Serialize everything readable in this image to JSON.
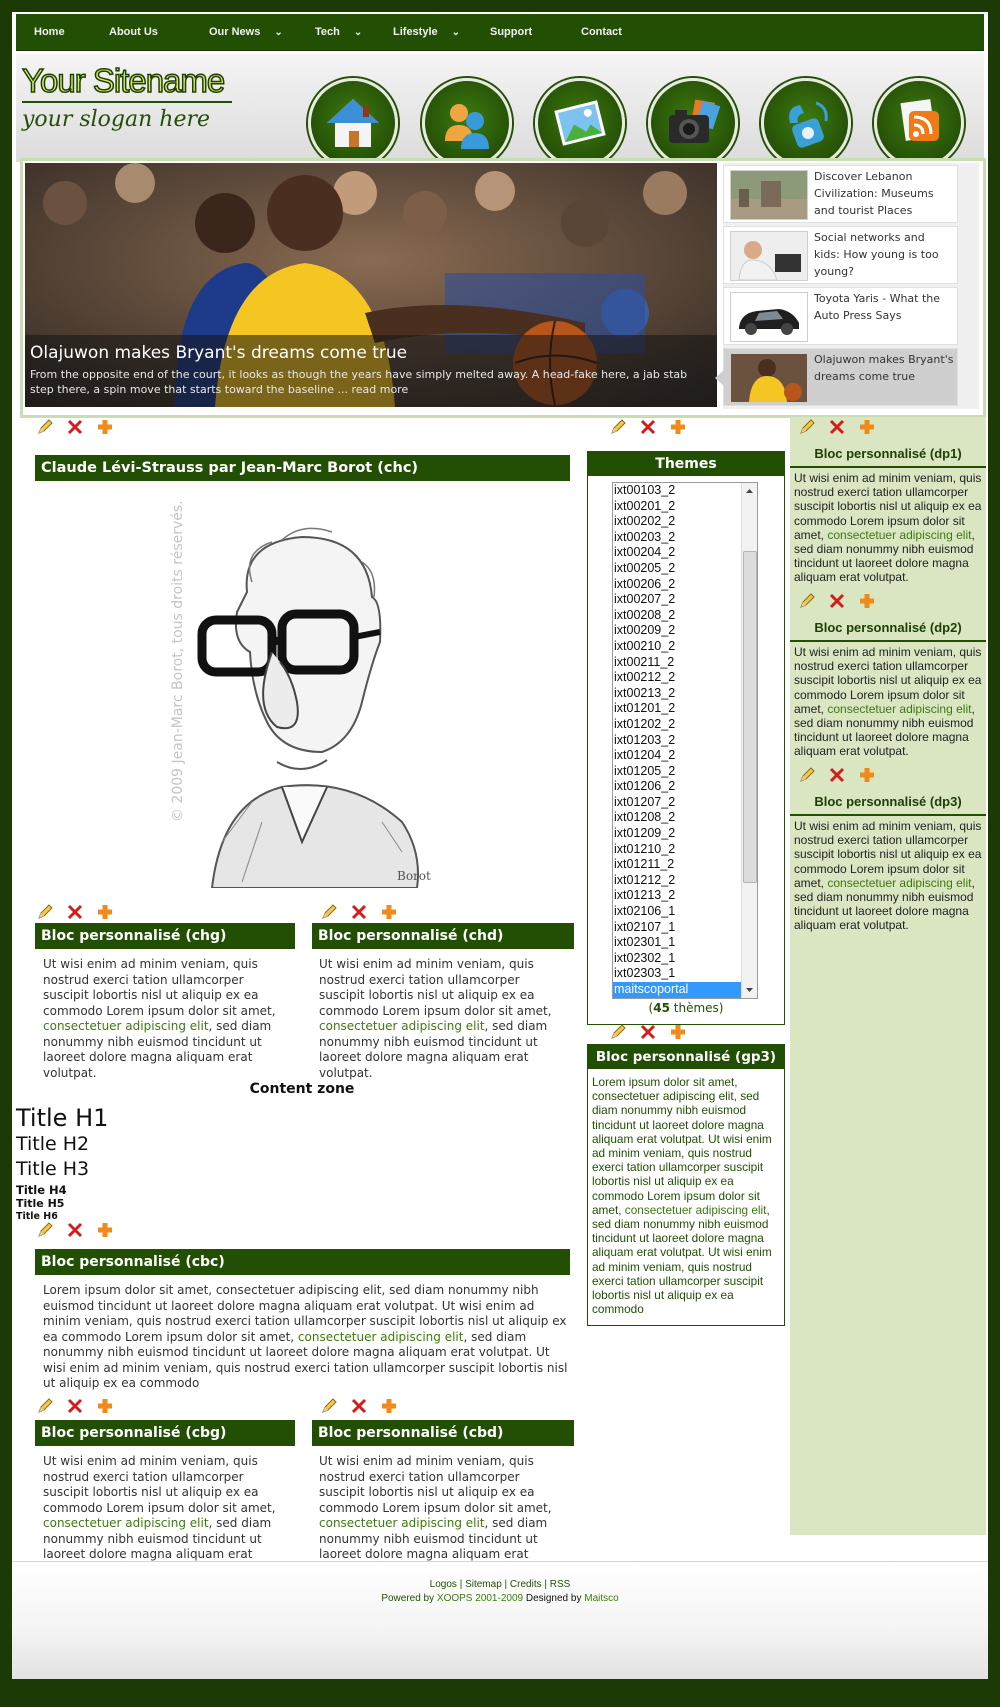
{
  "nav": [
    {
      "label": "Home",
      "has_menu": false
    },
    {
      "label": "About Us",
      "has_menu": false
    },
    {
      "label": "Our News",
      "has_menu": true
    },
    {
      "label": "Tech",
      "has_menu": true
    },
    {
      "label": "Lifestyle",
      "has_menu": true
    },
    {
      "label": "Support",
      "has_menu": false
    },
    {
      "label": "Contact",
      "has_menu": false
    }
  ],
  "header": {
    "site_name": "Your Sitename",
    "slogan": "your slogan here",
    "icons": [
      "home-icon",
      "users-icon",
      "picture-icon",
      "camera-icon",
      "phone-icon",
      "rss-icon"
    ]
  },
  "slider": {
    "main": {
      "title": "Olajuwon makes Bryant's dreams come true",
      "text": "From the opposite end of the court, it looks as though the years have simply melted away. A head-fake here, a jab stab step there, a spin move that starts toward the baseline ... read more"
    },
    "items": [
      {
        "title": "Discover Lebanon Civilization: Museums and tourist Places",
        "active": false
      },
      {
        "title": "Social networks and kids: How young is too young?",
        "active": false
      },
      {
        "title": "Toyota Yaris - What the Auto Press Says",
        "active": false
      },
      {
        "title": "Olajuwon makes Bryant's dreams come true",
        "active": true
      }
    ]
  },
  "blocks": {
    "chc": {
      "title": "Claude Lévi-Strauss par Jean-Marc Borot (chc)",
      "image_caption": "© 2009 Jean-Marc Borot, tous droits réservés."
    },
    "chg": {
      "title": "Bloc personnalisé (chg)",
      "text_a": "Ut wisi enim ad minim veniam, quis nostrud exerci tation ullamcorper suscipit lobortis nisl ut aliquip ex ea commodo Lorem ipsum dolor sit amet, ",
      "link": "consectetuer adipiscing elit",
      "text_b": ", sed diam nonummy nibh euismod tincidunt ut laoreet dolore magna aliquam erat volutpat."
    },
    "chd": {
      "title": "Bloc personnalisé (chd)",
      "text_a": "Ut wisi enim ad minim veniam, quis nostrud exerci tation ullamcorper suscipit lobortis nisl ut aliquip ex ea commodo Lorem ipsum dolor sit amet, ",
      "link": "consectetuer adipiscing elit",
      "text_b": ", sed diam nonummy nibh euismod tincidunt ut laoreet dolore magna aliquam erat volutpat."
    },
    "cbc": {
      "title": "Bloc personnalisé (cbc)",
      "text_a": "Lorem ipsum dolor sit amet, consectetuer adipiscing elit, sed diam nonummy nibh euismod tincidunt ut laoreet dolore magna aliquam erat volutpat. Ut wisi enim ad minim veniam, quis nostrud exerci tation ullamcorper suscipit lobortis nisl ut aliquip ex ea commodo Lorem ipsum dolor sit amet, ",
      "link": "consectetuer adipiscing elit",
      "text_b": ", sed diam nonummy nibh euismod tincidunt ut laoreet dolore magna aliquam erat volutpat. Ut wisi enim ad minim veniam, quis nostrud exerci tation ullamcorper suscipit lobortis nisl ut aliquip ex ea commodo"
    },
    "cbg": {
      "title": "Bloc personnalisé (cbg)",
      "text_a": "Ut wisi enim ad minim veniam, quis nostrud exerci tation ullamcorper suscipit lobortis nisl ut aliquip ex ea commodo Lorem ipsum dolor sit amet, ",
      "link": "consectetuer adipiscing elit",
      "text_b": ", sed diam nonummy nibh euismod tincidunt ut laoreet dolore magna aliquam erat volutpat."
    },
    "cbd": {
      "title": "Bloc personnalisé (cbd)",
      "text_a": "Ut wisi enim ad minim veniam, quis nostrud exerci tation ullamcorper suscipit lobortis nisl ut aliquip ex ea commodo Lorem ipsum dolor sit amet, ",
      "link": "consectetuer adipiscing elit",
      "text_b": ", sed diam nonummy nibh euismod tincidunt ut laoreet dolore magna aliquam erat volutpat."
    },
    "gp3": {
      "title": "Bloc personnalisé (gp3)",
      "text_a": "Lorem ipsum dolor sit amet, consectetuer adipiscing elit, sed diam nonummy nibh euismod tincidunt ut laoreet dolore magna aliquam erat volutpat. Ut wisi enim ad minim veniam, quis nostrud exerci tation ullamcorper suscipit lobortis nisl ut aliquip ex ea commodo Lorem ipsum dolor sit amet, ",
      "link": "consectetuer adipiscing elit",
      "text_b": ", sed diam nonummy nibh euismod tincidunt ut laoreet dolore magna aliquam erat volutpat. Ut wisi enim ad minim veniam, quis nostrud exerci tation ullamcorper suscipit lobortis nisl ut aliquip ex ea commodo"
    },
    "dp1": {
      "title": "Bloc personnalisé (dp1)",
      "text_a": "Ut wisi enim ad minim veniam, quis nostrud exerci tation ullamcorper suscipit lobortis nisl ut aliquip ex ea commodo Lorem ipsum dolor sit amet, ",
      "link": "consectetuer adipiscing elit",
      "text_b": ", sed diam nonummy nibh euismod tincidunt ut laoreet dolore magna aliquam erat volutpat."
    },
    "dp2": {
      "title": "Bloc personnalisé (dp2)",
      "text_a": "Ut wisi enim ad minim veniam, quis nostrud exerci tation ullamcorper suscipit lobortis nisl ut aliquip ex ea commodo Lorem ipsum dolor sit amet, ",
      "link": "consectetuer adipiscing elit",
      "text_b": ", sed diam nonummy nibh euismod tincidunt ut laoreet dolore magna aliquam erat volutpat."
    },
    "dp3": {
      "title": "Bloc personnalisé (dp3)",
      "text_a": "Ut wisi enim ad minim veniam, quis nostrud exerci tation ullamcorper suscipit lobortis nisl ut aliquip ex ea commodo Lorem ipsum dolor sit amet, ",
      "link": "consectetuer adipiscing elit",
      "text_b": ", sed diam nonummy nibh euismod tincidunt ut laoreet dolore magna aliquam erat volutpat."
    }
  },
  "content_zone": {
    "heading": "Content zone",
    "h1": "Title H1",
    "h2": "Title H2",
    "h3": "Title H3",
    "h4": "Title H4",
    "h5": "Title H5",
    "h6": "Title H6"
  },
  "themes": {
    "title": "Themes",
    "options": [
      "ixt00103_2",
      "ixt00201_2",
      "ixt00202_2",
      "ixt00203_2",
      "ixt00204_2",
      "ixt00205_2",
      "ixt00206_2",
      "ixt00207_2",
      "ixt00208_2",
      "ixt00209_2",
      "ixt00210_2",
      "ixt00211_2",
      "ixt00212_2",
      "ixt00213_2",
      "ixt01201_2",
      "ixt01202_2",
      "ixt01203_2",
      "ixt01204_2",
      "ixt01205_2",
      "ixt01206_2",
      "ixt01207_2",
      "ixt01208_2",
      "ixt01209_2",
      "ixt01210_2",
      "ixt01211_2",
      "ixt01212_2",
      "ixt01213_2",
      "ixt02106_1",
      "ixt02107_1",
      "ixt02301_1",
      "ixt02302_1",
      "ixt02303_1",
      "maitscoportal"
    ],
    "selected": "maitscoportal",
    "count_open": "(",
    "count": "45",
    "count_suffix": " thèmes)"
  },
  "tool_icons": {
    "edit": "edit-pencil-icon",
    "delete": "delete-x-icon",
    "add": "add-plus-icon"
  },
  "footer": {
    "links": [
      "Logos",
      "Sitemap",
      "Credits",
      "RSS"
    ],
    "separator": " | ",
    "powered_by": "Powered by ",
    "xoops": "XOOPS 2001-2009",
    "designed_by": " Designed by ",
    "designer": "Maitsco"
  },
  "colors": {
    "brand_green": "#234f05",
    "link_green": "#3d7a0f",
    "sidebar_bg": "#d9e6c1",
    "page_bg": "#1c3a06",
    "selected_option": "#3399ff"
  }
}
